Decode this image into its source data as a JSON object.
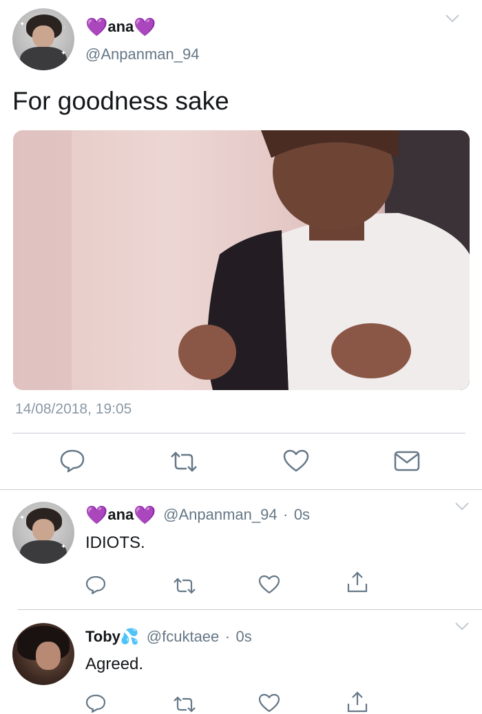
{
  "main_tweet": {
    "display_name": "ana",
    "heart_emoji": "💜",
    "handle": "@Anpanman_94",
    "text": "For goodness sake",
    "timestamp": "14/08/2018, 19:05",
    "actions": [
      "reply-icon",
      "retweet-icon",
      "like-icon",
      "message-icon"
    ]
  },
  "replies": [
    {
      "display_name": "ana",
      "heart_emoji": "💜",
      "handle": "@Anpanman_94",
      "time": "0s",
      "text": "IDIOTS.",
      "actions": [
        "reply-icon",
        "retweet-icon",
        "like-icon",
        "share-icon"
      ]
    },
    {
      "display_name": "Toby",
      "emoji": "💦",
      "handle": "@fcuktaee",
      "time": "0s",
      "text": "Agreed.",
      "actions": [
        "reply-icon",
        "retweet-icon",
        "like-icon",
        "share-icon"
      ]
    }
  ],
  "separator": "·",
  "colors": {
    "heart": "#9b3fe0",
    "secondary_text": "#657786",
    "divider": "#c8cdd2"
  }
}
